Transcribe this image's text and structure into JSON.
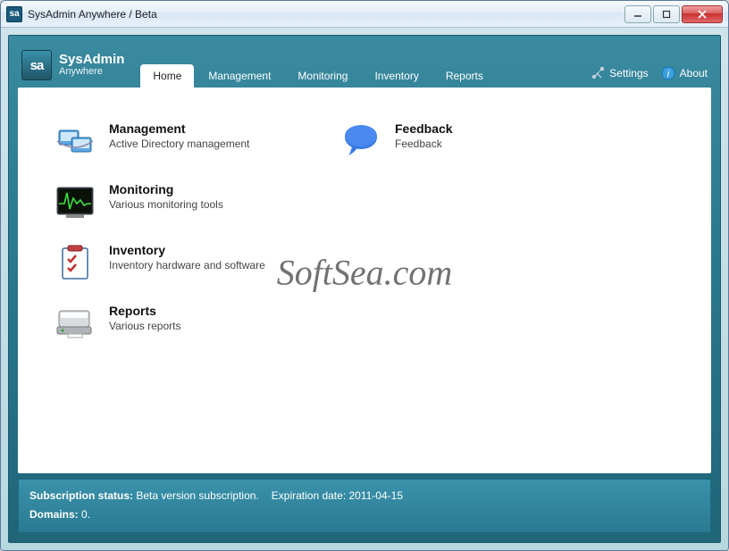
{
  "window": {
    "title": "SysAdmin Anywhere / Beta",
    "icon_text": "sa"
  },
  "brand": {
    "mark": "sa",
    "name": "SysAdmin",
    "sub": "Anywhere"
  },
  "tabs": [
    {
      "label": "Home",
      "active": true
    },
    {
      "label": "Management",
      "active": false
    },
    {
      "label": "Monitoring",
      "active": false
    },
    {
      "label": "Inventory",
      "active": false
    },
    {
      "label": "Reports",
      "active": false
    }
  ],
  "header_links": {
    "settings": "Settings",
    "about": "About"
  },
  "tiles": {
    "management": {
      "title": "Management",
      "desc": "Active Directory management"
    },
    "feedback": {
      "title": "Feedback",
      "desc": "Feedback"
    },
    "monitoring": {
      "title": "Monitoring",
      "desc": "Various monitoring tools"
    },
    "inventory": {
      "title": "Inventory",
      "desc": "Inventory hardware and software"
    },
    "reports": {
      "title": "Reports",
      "desc": "Various reports"
    }
  },
  "watermark": "SoftSea.com",
  "footer": {
    "sub_label": "Subscription status:",
    "sub_value": "Beta version subscription.",
    "exp_label": "Expiration date:",
    "exp_value": "2011-04-15",
    "dom_label": "Domains:",
    "dom_value": "0."
  }
}
